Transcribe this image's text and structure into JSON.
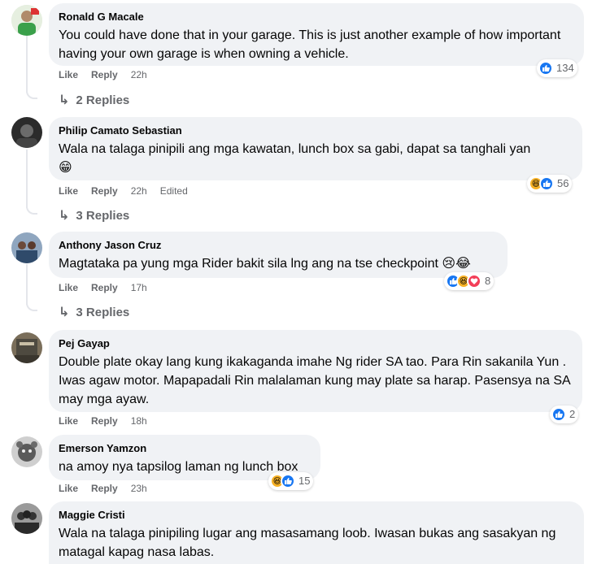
{
  "comments": [
    {
      "author": "Ronald G Macale",
      "text": "You could have done that in your garage. This is just another example of how important having your own garage is when owning a vehicle.",
      "like": "Like",
      "reply": "Reply",
      "time": "22h",
      "edited": "",
      "reaction_icons": [
        "like-icon"
      ],
      "reaction_count": "134",
      "replies_label": "2 Replies"
    },
    {
      "author": "Philip Camato Sebastian",
      "text": "Wala na talaga pinipili ang mga kawatan, lunch box sa gabi, dapat sa tanghali yan",
      "emoji": "😁",
      "like": "Like",
      "reply": "Reply",
      "time": "22h",
      "edited": "Edited",
      "reaction_icons": [
        "haha-icon",
        "like-icon"
      ],
      "reaction_count": "56",
      "replies_label": "3 Replies"
    },
    {
      "author": "Anthony Jason Cruz",
      "text": "Magtataka pa yung mga Rider bakit sila lng ang na tse checkpoint 😢😂",
      "like": "Like",
      "reply": "Reply",
      "time": "17h",
      "edited": "",
      "reaction_icons": [
        "like-icon",
        "haha-icon",
        "love-icon"
      ],
      "reaction_count": "8",
      "replies_label": "3 Replies"
    },
    {
      "author": "Pej Gayap",
      "text": "Double plate okay lang kung ikakaganda imahe Ng rider SA tao. Para Rin sakanila Yun . Iwas agaw motor. Mapapadali Rin malalaman kung may plate sa harap. Pasensya na SA may mga ayaw.",
      "like": "Like",
      "reply": "Reply",
      "time": "18h",
      "edited": "",
      "reaction_icons": [
        "like-icon"
      ],
      "reaction_count": "2"
    },
    {
      "author": "Emerson Yamzon",
      "text": "na amoy nya tapsilog laman ng lunch box",
      "like": "Like",
      "reply": "Reply",
      "time": "23h",
      "edited": "",
      "reaction_icons": [
        "haha-icon",
        "like-icon"
      ],
      "reaction_count": "15"
    },
    {
      "author": "Maggie Cristi",
      "text": "Wala na talaga pinipiling lugar ang masasamang loob. Iwasan bukas ang sasakyan ng matagal kapag nasa labas."
    }
  ],
  "colors": {
    "bubble": "#f0f2f5",
    "secondary_text": "#65676b",
    "like_blue": "#1877f2",
    "haha_yellow": "#f7b125",
    "love_red": "#f33e58"
  }
}
